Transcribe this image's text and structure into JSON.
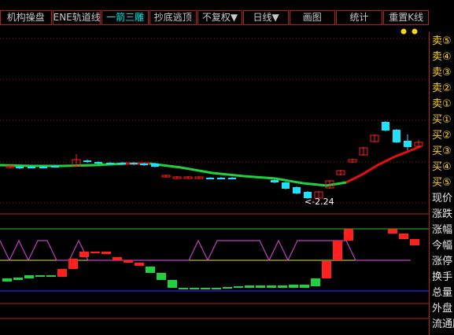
{
  "toolbar": {
    "buttons": [
      {
        "label": "机构操盘",
        "accent": false
      },
      {
        "label": "ENE轨道线",
        "accent": false
      },
      {
        "label": "一箭三雕",
        "accent": true
      },
      {
        "label": "抄底逃顶",
        "accent": false
      },
      {
        "label": "不复权▼",
        "accent": false
      },
      {
        "label": "日线▼",
        "accent": false
      },
      {
        "label": "画图",
        "accent": false
      },
      {
        "label": "统计",
        "accent": false
      },
      {
        "label": "重置K线",
        "accent": false
      }
    ]
  },
  "sidebar": {
    "items": [
      {
        "label": "卖⑤",
        "color": "yellow"
      },
      {
        "label": "卖④",
        "color": "yellow"
      },
      {
        "label": "卖③",
        "color": "yellow"
      },
      {
        "label": "卖②",
        "color": "yellow"
      },
      {
        "label": "卖①",
        "color": "yellow"
      },
      {
        "label": "买①",
        "color": "yellow"
      },
      {
        "label": "买②",
        "color": "yellow"
      },
      {
        "label": "买③",
        "color": "yellow"
      },
      {
        "label": "买④",
        "color": "yellow"
      },
      {
        "label": "买⑤",
        "color": "yellow"
      },
      {
        "label": "现价",
        "color": "white"
      },
      {
        "label": "涨跌",
        "color": "white"
      },
      {
        "label": "涨幅",
        "color": "white"
      },
      {
        "label": "今幅",
        "color": "white"
      },
      {
        "label": "涨停",
        "color": "white"
      },
      {
        "label": "换手",
        "color": "white"
      },
      {
        "label": "总量",
        "color": "white"
      },
      {
        "label": "外盘",
        "color": "white"
      },
      {
        "label": "流通股",
        "color": "white"
      }
    ]
  },
  "chart_data": {
    "type": "candlestick",
    "min_price_annotation": "<-2.24",
    "colors": {
      "up": "#ff2020",
      "down": "#20e0ff",
      "ma_down": "#20d040",
      "ma_up": "#e01010",
      "indicator_line": "#c040c0",
      "baseline": "#e0e040",
      "divider": "#2020c0"
    }
  }
}
